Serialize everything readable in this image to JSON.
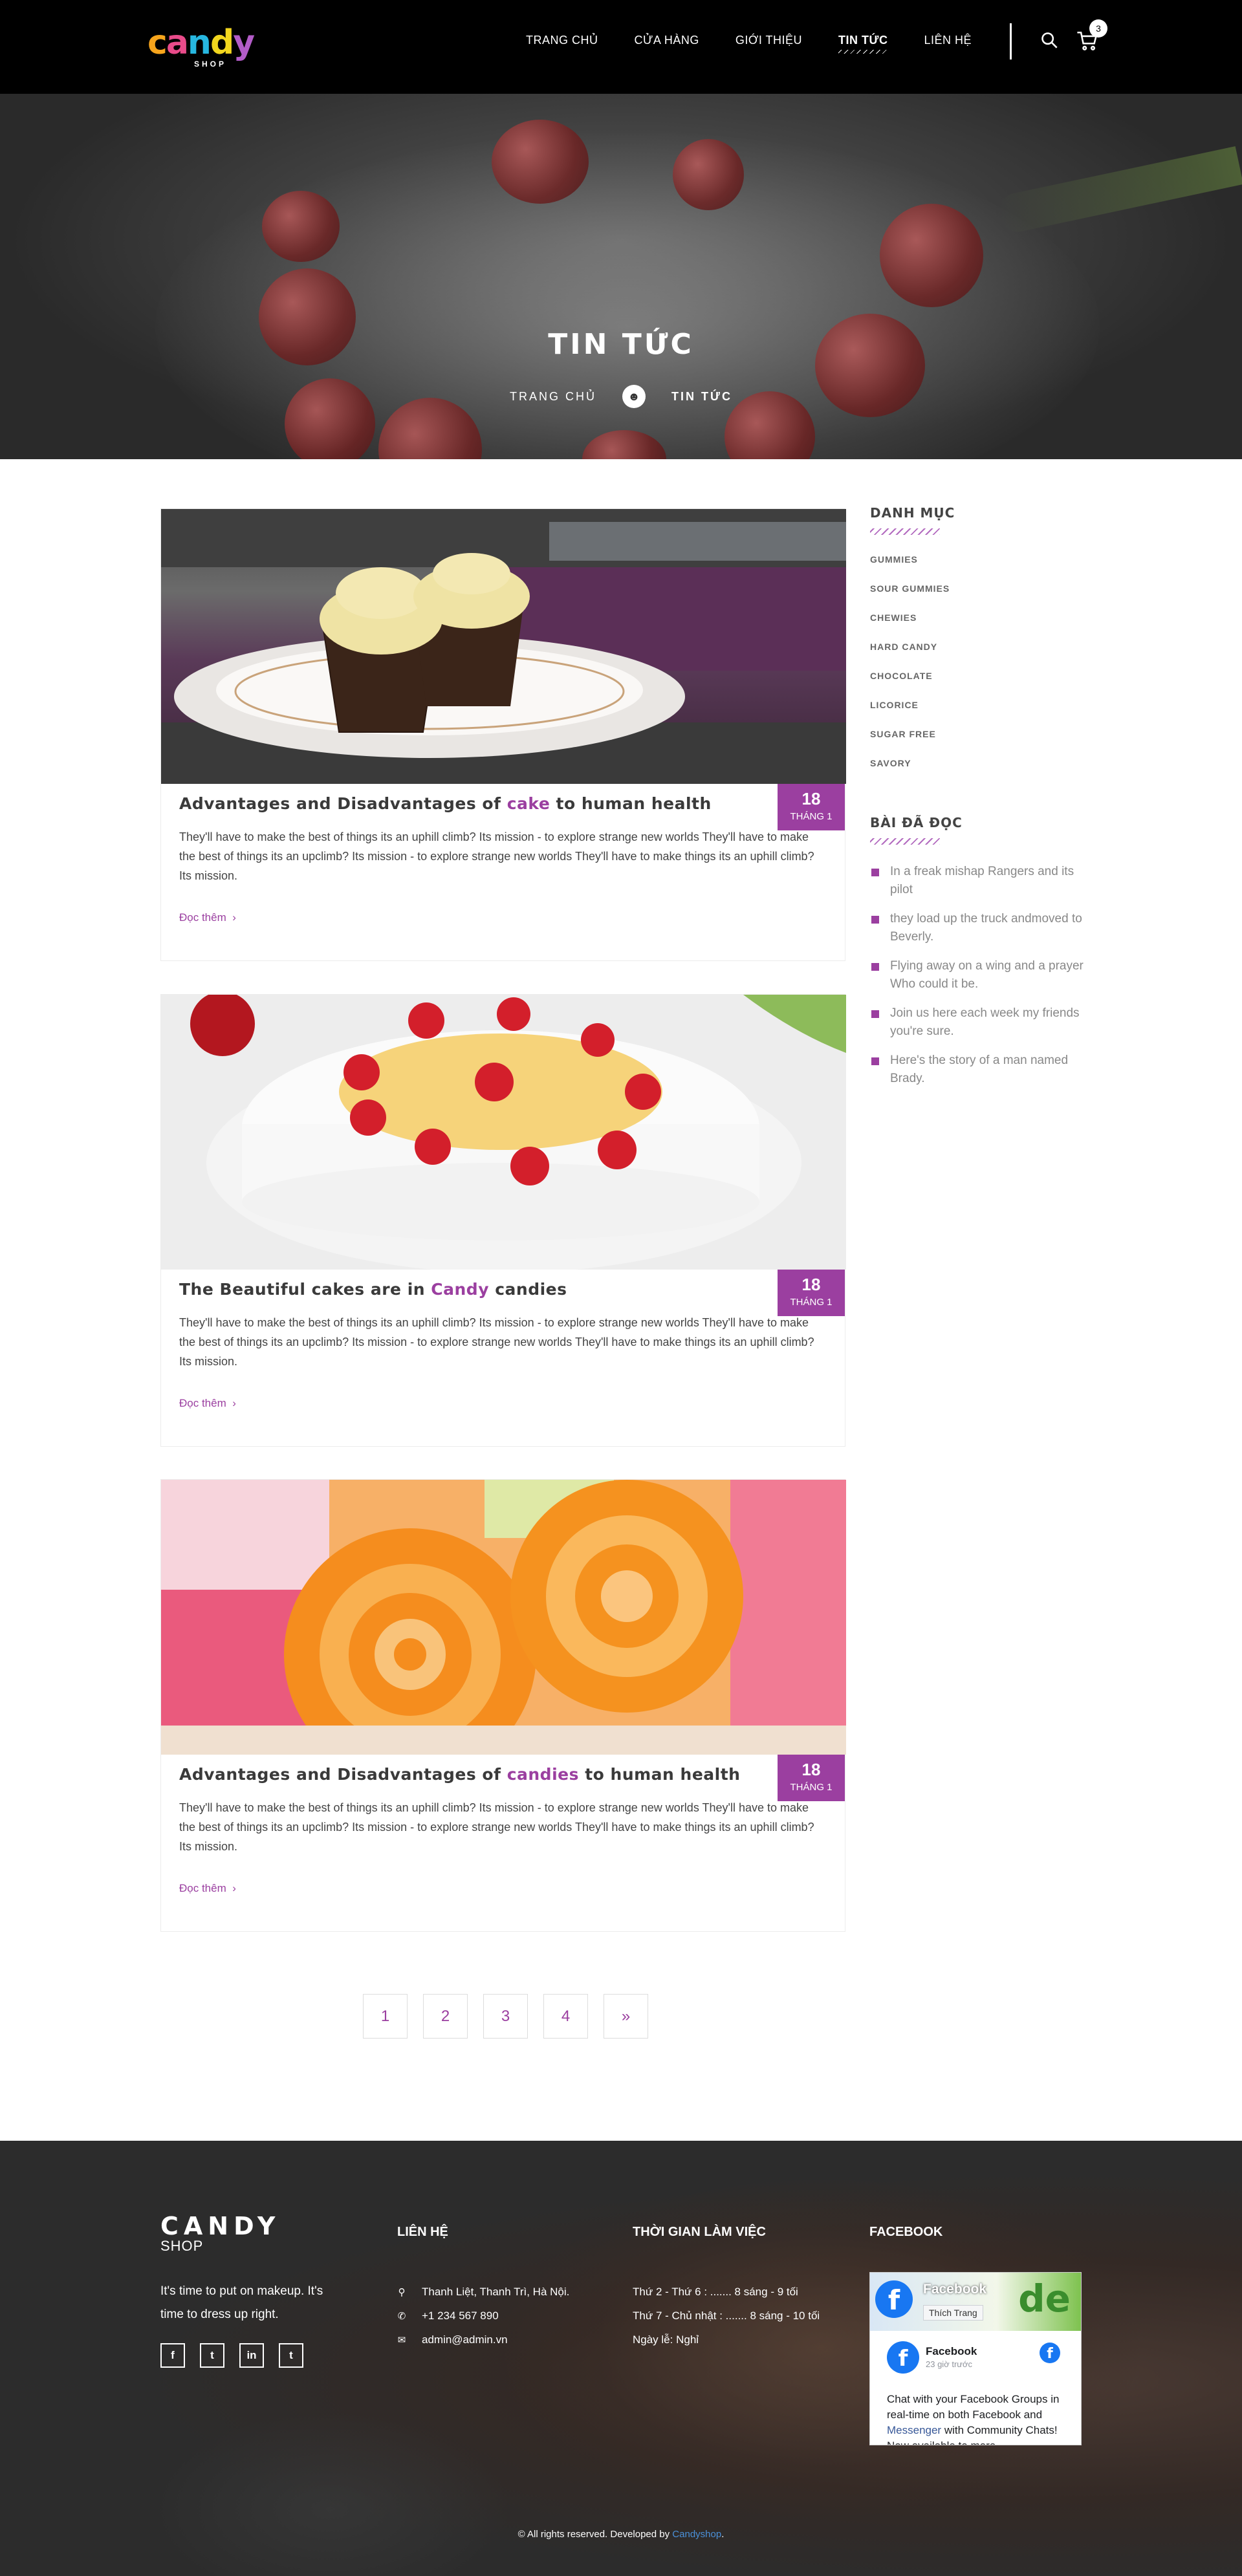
{
  "header": {
    "logo_text": [
      "c",
      "a",
      "n",
      "d",
      "y"
    ],
    "logo_sub": "SHOP",
    "nav": [
      {
        "label": "TRANG CHỦ"
      },
      {
        "label": "CỬA HÀNG"
      },
      {
        "label": "GIỚI THIỆU"
      },
      {
        "label": "TIN TỨC"
      },
      {
        "label": "LIÊN HỆ"
      }
    ],
    "active_nav": "TIN TỨC",
    "cart_count": "3",
    "icons": {
      "search": "search-icon",
      "cart": "cart-icon"
    }
  },
  "hero": {
    "title": "TIN TỨC",
    "breadcrumb_home": "TRANG CHỦ",
    "breadcrumb_current": "TIN TỨC"
  },
  "posts": [
    {
      "title_before": "Advantages and Disadvantages of ",
      "title_highlight": "cake",
      "title_after": " to human health",
      "day": "18",
      "month": "THÁNG 1",
      "excerpt": "They'll have to make the best of things its an uphill climb? Its mission - to explore strange new worlds They'll have to make the best of things its an upclimb? Its mission - to explore strange new worlds They'll have to make things its an uphill climb? Its mission.",
      "read_more": "Đọc thêm"
    },
    {
      "title_before": "The Beautiful cakes are in ",
      "title_highlight": "Candy",
      "title_after": " candies",
      "day": "18",
      "month": "THÁNG 1",
      "excerpt": "They'll have to make the best of things its an uphill climb? Its mission - to explore strange new worlds They'll have to make the best of things its an upclimb? Its mission - to explore strange new worlds They'll have to make things its an uphill climb? Its mission.",
      "read_more": "Đọc thêm"
    },
    {
      "title_before": "Advantages and Disadvantages of ",
      "title_highlight": "candies",
      "title_after": " to human health",
      "day": "18",
      "month": "THÁNG 1",
      "excerpt": "They'll have to make the best of things its an uphill climb? Its mission - to explore strange new worlds They'll have to make the best of things its an upclimb? Its mission - to explore strange new worlds They'll have to make things its an uphill climb? Its mission.",
      "read_more": "Đọc thêm"
    }
  ],
  "sidebar": {
    "categories_title": "DANH MỤC",
    "categories": [
      "GUMMIES",
      "SOUR GUMMIES",
      "CHEWIES",
      "HARD CANDY",
      "CHOCOLATE",
      "LICORICE",
      "SUGAR FREE",
      "SAVORY"
    ],
    "recent_title": "BÀI ĐÃ ĐỌC",
    "recent": [
      "In a freak mishap Rangers and its pilot",
      "they load up the truck andmoved to Beverly.",
      "Flying away on a wing and a prayer Who could it be.",
      "Join us here each week my friends you're sure.",
      "Here's the story of a man named Brady."
    ]
  },
  "pagination": [
    "1",
    "2",
    "3",
    "4",
    "»"
  ],
  "footer": {
    "logo_big": "CANDY",
    "logo_small": "SHOP",
    "tagline": "It's time to put on makeup. It's time to dress up right.",
    "socials": [
      "f",
      "t",
      "in",
      "t"
    ],
    "contact_title": "LIÊN HỆ",
    "contact": [
      {
        "icon": "map-pin-icon",
        "text": "Thanh Liệt, Thanh Trì, Hà Nội."
      },
      {
        "icon": "phone-icon",
        "text": "+1 234 567 890"
      },
      {
        "icon": "envelope-icon",
        "text": "admin@admin.vn"
      }
    ],
    "hours_title": "THỜI GIAN LÀM VIỆC",
    "hours": [
      "Thứ 2 - Thứ 6 : ....... 8 sáng - 9 tối",
      "Thứ 7 - Chủ nhật : ....... 8 sáng - 10 tối",
      "Ngày lễ: Nghỉ"
    ],
    "facebook_title": "FACEBOOK",
    "fb_widget": {
      "page_name": "Facebook",
      "like_label": "Thích Trang",
      "cover_text": "de",
      "post_author": "Facebook",
      "post_time": "23 giờ trước",
      "post_text_before": "Chat with your Facebook Groups in real-time on both Facebook and ",
      "post_link": "Messenger",
      "post_text_after": " with Community Chats! Now available to more"
    },
    "copyright_before": "© All rights reserved. Developed by ",
    "copyright_brand": "Candyshop",
    "copyright_after": "."
  },
  "colors": {
    "accent": "#9b3fa0",
    "header_bg": "#000000",
    "footer_bg": "#2e2e2e"
  }
}
